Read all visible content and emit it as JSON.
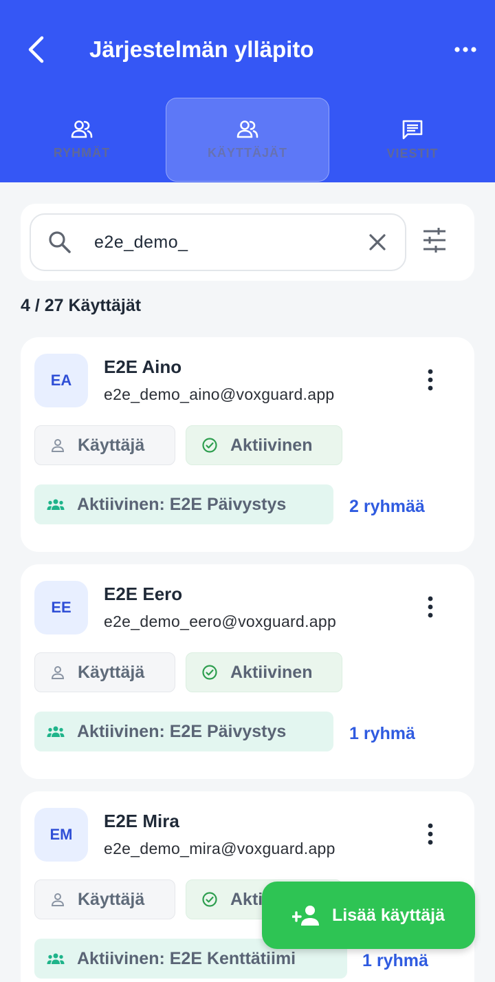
{
  "header": {
    "title": "Järjestelmän ylläpito",
    "tabs": [
      {
        "label": "RYHMÄT",
        "icon": "people-icon"
      },
      {
        "label": "KÄYTTÄJÄT",
        "icon": "people-icon",
        "active": true
      },
      {
        "label": "VIESTIT",
        "icon": "message-icon"
      }
    ]
  },
  "search": {
    "value": "e2e_demo_",
    "placeholder": ""
  },
  "count_label": "4 / 27 Käyttäjät",
  "users": [
    {
      "initials": "EA",
      "name": "E2E Aino",
      "email": "e2e_demo_aino@voxguard.app",
      "role": "Käyttäjä",
      "status": "Aktiivinen",
      "active_group": "Aktiivinen: E2E Päivystys",
      "group_count": "2 ryhmää"
    },
    {
      "initials": "EE",
      "name": "E2E Eero",
      "email": "e2e_demo_eero@voxguard.app",
      "role": "Käyttäjä",
      "status": "Aktiivinen",
      "active_group": "Aktiivinen: E2E Päivystys",
      "group_count": "1 ryhmä"
    },
    {
      "initials": "EM",
      "name": "E2E Mira",
      "email": "e2e_demo_mira@voxguard.app",
      "role": "Käyttäjä",
      "status": "Aktiivinen",
      "active_group": "Aktiivinen: E2E Kenttätiimi",
      "group_count": "1 ryhmä"
    }
  ],
  "fab": {
    "label": "Lisää käyttäjä"
  },
  "colors": {
    "header": "#3557f5",
    "accent_link": "#2f5be0",
    "fab": "#2ec454",
    "status_green": "#2e9e4f",
    "group_teal": "#1fb48a"
  }
}
